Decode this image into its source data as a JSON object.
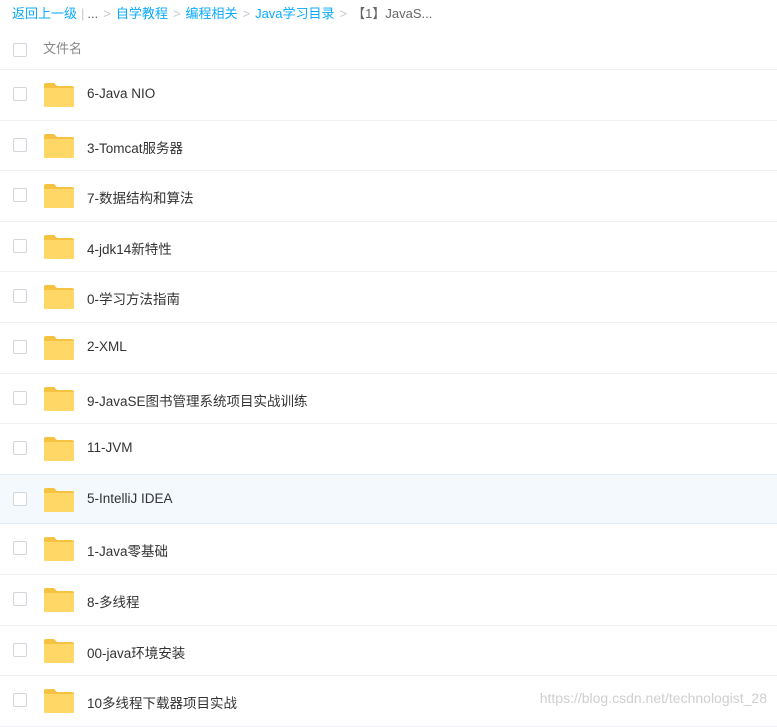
{
  "breadcrumb": {
    "back": "返回上一级",
    "ellipsis": "...",
    "items": [
      "自学教程",
      "编程相关",
      "Java学习目录"
    ],
    "current": "【1】JavaS..."
  },
  "list_header": {
    "column_name": "文件名"
  },
  "files": [
    {
      "name": "6-Java NIO",
      "type": "folder"
    },
    {
      "name": "3-Tomcat服务器",
      "type": "folder"
    },
    {
      "name": "7-数据结构和算法",
      "type": "folder"
    },
    {
      "name": "4-jdk14新特性",
      "type": "folder"
    },
    {
      "name": "0-学习方法指南",
      "type": "folder"
    },
    {
      "name": "2-XML",
      "type": "folder"
    },
    {
      "name": "9-JavaSE图书管理系统项目实战训练",
      "type": "folder"
    },
    {
      "name": "11-JVM",
      "type": "folder"
    },
    {
      "name": "5-IntelliJ IDEA",
      "type": "folder",
      "hovered": true
    },
    {
      "name": "1-Java零基础",
      "type": "folder"
    },
    {
      "name": "8-多线程",
      "type": "folder"
    },
    {
      "name": "00-java环境安装",
      "type": "folder"
    },
    {
      "name": "10多线程下载器项目实战",
      "type": "folder"
    }
  ],
  "watermark": "https://blog.csdn.net/technologist_28",
  "colors": {
    "link": "#09aaff",
    "folder_body": "#ffd766",
    "folder_tab": "#f5c242",
    "hover_row": "#f3f9fd"
  }
}
